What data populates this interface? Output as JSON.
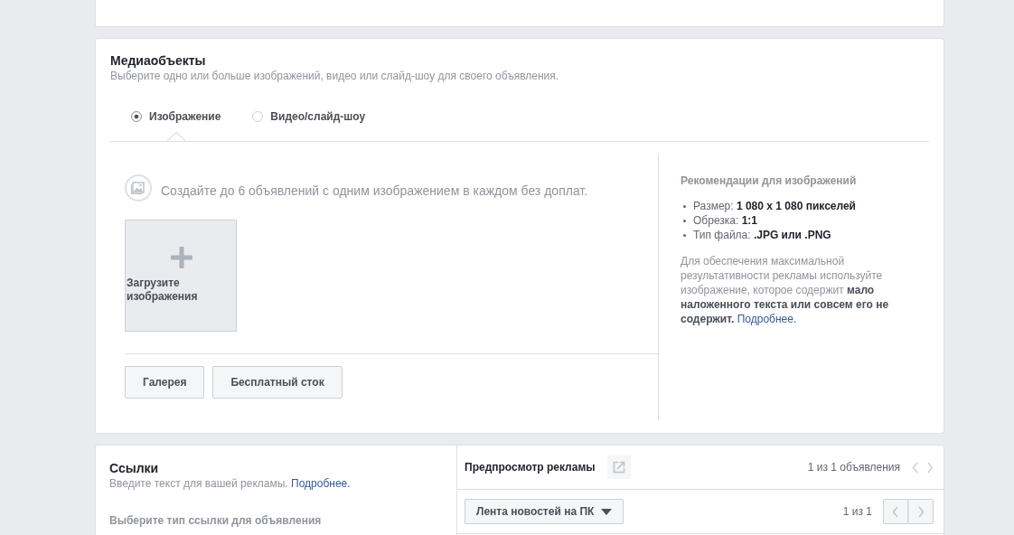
{
  "media": {
    "title": "Медиаобъекты",
    "subtitle": "Выберите одно или больше изображений, видео или слайд-шоу для своего объявления.",
    "tabs": [
      {
        "label": "Изображение",
        "selected": true
      },
      {
        "label": "Видео/слайд-шоу",
        "selected": false
      }
    ],
    "hint": "Создайте до 6 объявлений с одним изображением в каждом без доплат.",
    "upload_tile": {
      "label": "Загрузите изображения"
    },
    "buttons": [
      "Галерея",
      "Бесплатный сток"
    ],
    "recommendations": {
      "title": "Рекомендации для изображений",
      "items": [
        "Размер: **1 080 x 1 080 пикселей**",
        "Обрезка: **1:1**",
        "Тип файла: **.JPG или .PNG**"
      ],
      "text": "Для обеспечения максимальной результативности рекламы используйте изображение, которое содержит **мало наложенного текста или совсем его не содержит.**",
      "link": "Подробнее."
    }
  },
  "links": {
    "title": "Ссылки",
    "subtitle": "Введите текст для вашей рекламы.",
    "link": "Подробнее.",
    "field_label": "Выберите тип ссылки для объявления"
  },
  "preview": {
    "title": "Предпросмотр рекламы",
    "counter": "1 из 1 объявления",
    "pager": [
      {
        "kind": "prev",
        "disabled": true
      },
      {
        "kind": "next",
        "disabled": true
      }
    ],
    "placement": "Лента новостей на ПК",
    "placement_counter": "1 из 1",
    "placement_pager": [
      {
        "kind": "prev",
        "disabled": true
      },
      {
        "kind": "next",
        "disabled": true
      }
    ]
  }
}
